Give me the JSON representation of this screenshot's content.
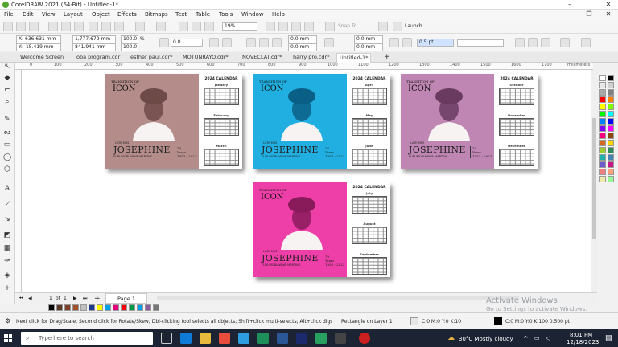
{
  "app": {
    "title": "CorelDRAW 2021 (64-Bit) - Untitled-1*"
  },
  "menu": [
    "File",
    "Edit",
    "View",
    "Layout",
    "Object",
    "Effects",
    "Bitmaps",
    "Text",
    "Table",
    "Tools",
    "Window",
    "Help"
  ],
  "toolbar": {
    "zoom": "19%",
    "snap_to": "Snap To",
    "launch": "Launch"
  },
  "propbar": {
    "x": "X: 636.631 mm",
    "y": "Y: -15.419 mm",
    "width": "1,777.679 mm",
    "height": "841.941 mm",
    "scale_w": "100.0",
    "scale_h": "100.0",
    "pct": "%",
    "angle": "0.0",
    "corner1": "0.0 mm",
    "corner2": "0.0 mm",
    "corner3": "0.0 mm",
    "corner4": "0.0 mm",
    "outline": "0.5 pt"
  },
  "tabs": [
    {
      "label": "Welcome Screen"
    },
    {
      "label": "oba program.cdr"
    },
    {
      "label": "esther paul.cdr*"
    },
    {
      "label": "MOTUNRAYO.cdr*"
    },
    {
      "label": "NOVECLAT.cdr*"
    },
    {
      "label": "harry pro.cdr*"
    },
    {
      "label": "Untitled-1*"
    }
  ],
  "ruler_units": "millimeters",
  "ruler_ticks": [
    "0",
    "100",
    "200",
    "300",
    "400",
    "500",
    "600",
    "700",
    "800",
    "900",
    "1000",
    "1100",
    "1200",
    "1300",
    "1400",
    "1500",
    "1600",
    "1700"
  ],
  "cards": [
    {
      "bg": "#b48c8a",
      "tint": "#6e4a48",
      "months": [
        "January",
        "February",
        "March"
      ]
    },
    {
      "bg": "#21aee0",
      "tint": "#0a5f86",
      "months": [
        "April",
        "May",
        "June"
      ]
    },
    {
      "bg": "#c086b3",
      "tint": "#6a3b61",
      "months": [
        "October",
        "November",
        "December"
      ]
    },
    {
      "bg": "#ee3ea8",
      "tint": "#8a1b5a",
      "months": [
        "July",
        "August",
        "September"
      ]
    }
  ],
  "card_text": {
    "calendar_title": "2024 CALENDAR",
    "transition": "TRANSITION OF",
    "icon_word": "ICON",
    "late": "LATE MRS",
    "first_name": "JOSEPHINE",
    "surname": "FUBUMOBIAWWA MARTINS",
    "yrs_line1": "70",
    "yrs_line2": "Years",
    "yrs_line3": "1953 - 2023",
    "sub": "AND GOODIES"
  },
  "pagebar": {
    "page_index": "1",
    "of": "of",
    "total": "1",
    "page_tab": "Page 1"
  },
  "status": {
    "hint": "Next click for Drag/Scale; Second click for Rotate/Skew; Dbl-clicking tool selects all objects; Shift+click multi-selects; Alt+click digs",
    "object": "Rectangle on Layer 1",
    "fill": "C:0 M:0 Y:0 K:10",
    "outline": "C:0 M:0 Y:0 K:100  0.500 pt"
  },
  "watermark": {
    "line1": "Activate Windows",
    "line2": "Go to Settings to activate Windows."
  },
  "taskbar": {
    "search": "Type here to search",
    "weather": "30°C  Mostly cloudy",
    "time": "8:01 PM",
    "date": "12/18/2023"
  },
  "palette_colors": [
    "#ffffff",
    "#000000",
    "#e8e8e8",
    "#d0d0d0",
    "#a8a8a8",
    "#808080",
    "#ff0000",
    "#ff7f00",
    "#ffff00",
    "#7fff00",
    "#00ff00",
    "#00ffff",
    "#007fff",
    "#0000ff",
    "#7f00ff",
    "#ff00ff",
    "#ff007f",
    "#8b4513",
    "#d2691e",
    "#ffd700",
    "#9acd32",
    "#2e8b57",
    "#20b2aa",
    "#4682b4",
    "#6a5acd",
    "#c71585",
    "#f08080",
    "#ffa07a",
    "#eee8aa",
    "#98fb98"
  ],
  "strip_colors": [
    "#000000",
    "#5b3a29",
    "#7b3f2a",
    "#a0522d",
    "#c0c0c0",
    "#1e3a8a",
    "#ffff00",
    "#00a0e9",
    "#e4007f",
    "#ff0000",
    "#009944",
    "#00a0e9",
    "#8b5a9f",
    "#777777"
  ]
}
